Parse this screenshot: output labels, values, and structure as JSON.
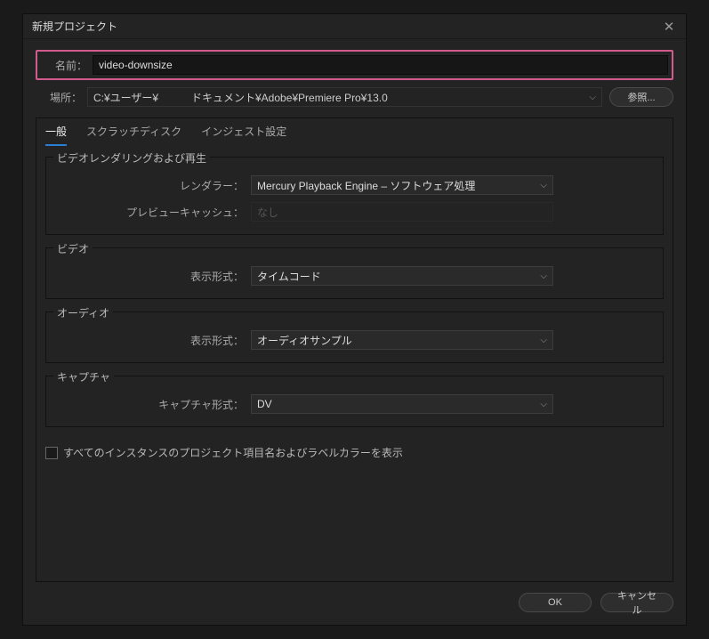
{
  "dialog": {
    "title": "新規プロジェクト",
    "name_label": "名前：",
    "name_value": "video-downsize",
    "location_label": "場所：",
    "location_path_part1": "C:¥ユーザー¥",
    "location_path_part2": "ドキュメント¥Adobe¥Premiere Pro¥13.0",
    "browse_label": "参照..."
  },
  "tabs": {
    "general": "一般",
    "scratch": "スクラッチディスク",
    "ingest": "インジェスト設定"
  },
  "groups": {
    "rendering": {
      "title": "ビデオレンダリングおよび再生",
      "renderer_label": "レンダラー：",
      "renderer_value": "Mercury Playback Engine – ソフトウェア処理",
      "preview_label": "プレビューキャッシュ：",
      "preview_value": "なし"
    },
    "video": {
      "title": "ビデオ",
      "format_label": "表示形式：",
      "format_value": "タイムコード"
    },
    "audio": {
      "title": "オーディオ",
      "format_label": "表示形式：",
      "format_value": "オーディオサンプル"
    },
    "capture": {
      "title": "キャプチャ",
      "format_label": "キャプチャ形式：",
      "format_value": "DV"
    }
  },
  "checkbox_label": "すべてのインスタンスのプロジェクト項目名およびラベルカラーを表示",
  "footer": {
    "ok": "OK",
    "cancel": "キャンセル"
  }
}
